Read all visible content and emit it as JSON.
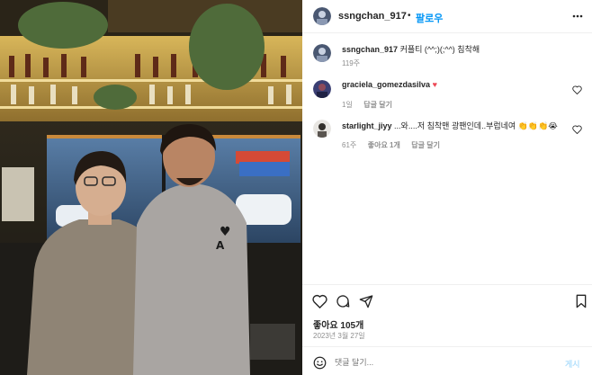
{
  "post": {
    "username": "ssngchan_917",
    "dot": "•",
    "follow_label": "팔로우",
    "more_icon": "more-horizontal-icon",
    "caption": "커플티 (^^;)(;^^) 침착해",
    "caption_age": "119주"
  },
  "comments": [
    {
      "username": "graciela_gomezdasilva",
      "text": "",
      "emoji": "♥",
      "age": "1일",
      "likes": "",
      "reply_label": "답글 달기"
    },
    {
      "username": "starlight_jiyy",
      "text": "...와....저 침착맨 광팬인데..부럽네여 👏👏👏😭",
      "age": "61주",
      "likes": "좋아요 1개",
      "reply_label": "답글 달기"
    }
  ],
  "actions": {
    "like_count": "좋아요 105개",
    "date": "2023년 3월 27일"
  },
  "composer": {
    "placeholder": "댓글 달기...",
    "post_label": "게시"
  },
  "colors": {
    "accent": "#0095f6",
    "heart": "#ed4956"
  }
}
